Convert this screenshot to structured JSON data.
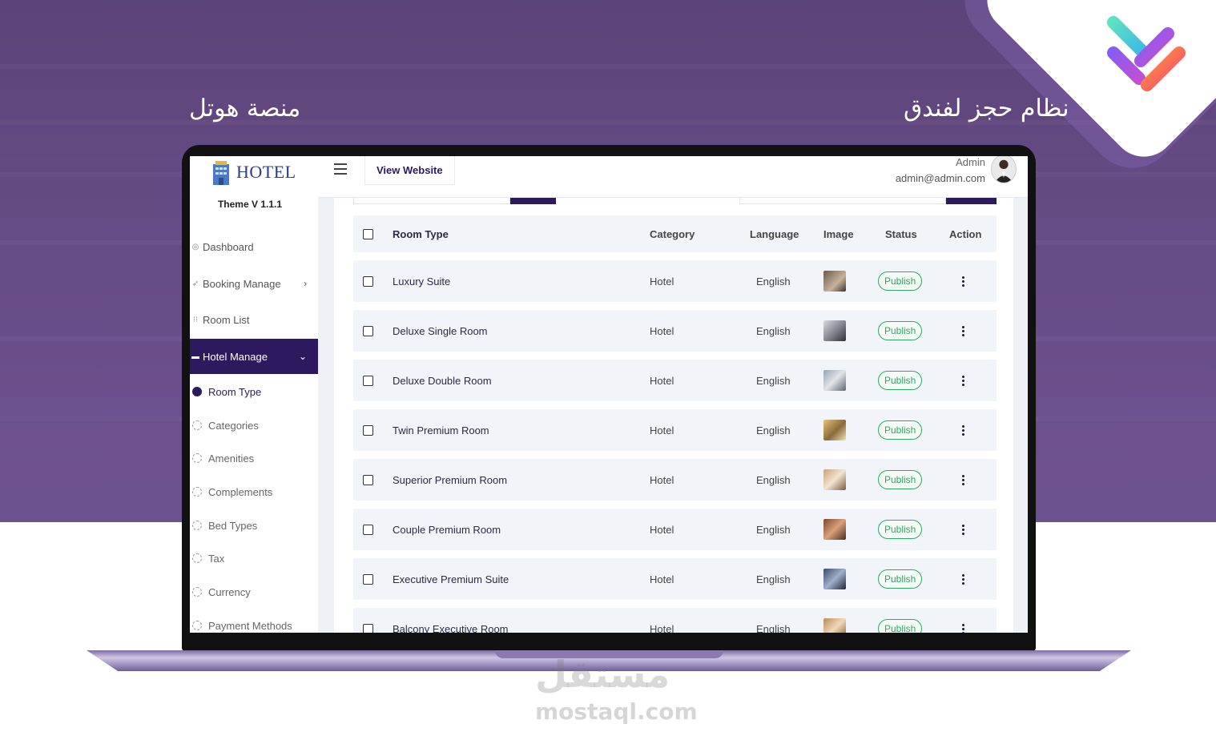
{
  "promo": {
    "title_right": "نظام حجز لفندق",
    "title_left": "منصة هوتل"
  },
  "app": {
    "logo_text": "HOTEL",
    "version": "Theme V 1.1.1"
  },
  "sidebar": {
    "items": [
      {
        "label": "Dashboard",
        "icon": "dashboard-icon"
      },
      {
        "label": "Booking Manage",
        "icon": "rocket-icon"
      },
      {
        "label": "Room List",
        "icon": "grid-icon"
      },
      {
        "label": "Hotel Manage",
        "icon": "bed-icon"
      }
    ],
    "sub_items": [
      "Room Type",
      "Categories",
      "Amenities",
      "Complements",
      "Bed Types",
      "Tax",
      "Currency",
      "Payment Methods"
    ],
    "active_sub_item": "Room Type"
  },
  "topbar": {
    "view_website_label": "View Website",
    "admin_name": "Admin",
    "admin_email": "admin@admin.com"
  },
  "table": {
    "headers": {
      "room_type": "Room Type",
      "category": "Category",
      "language": "Language",
      "image": "Image",
      "status": "Status",
      "action": "Action"
    },
    "rows": [
      {
        "room_type": "Luxury Suite",
        "category": "Hotel",
        "language": "English",
        "status": "Publish"
      },
      {
        "room_type": "Deluxe Single Room",
        "category": "Hotel",
        "language": "English",
        "status": "Publish"
      },
      {
        "room_type": "Deluxe Double Room",
        "category": "Hotel",
        "language": "English",
        "status": "Publish"
      },
      {
        "room_type": "Twin Premium Room",
        "category": "Hotel",
        "language": "English",
        "status": "Publish"
      },
      {
        "room_type": "Superior Premium Room",
        "category": "Hotel",
        "language": "English",
        "status": "Publish"
      },
      {
        "room_type": "Couple Premium Room",
        "category": "Hotel",
        "language": "English",
        "status": "Publish"
      },
      {
        "room_type": "Executive Premium Suite",
        "category": "Hotel",
        "language": "English",
        "status": "Publish"
      },
      {
        "room_type": "Balcony Executive Room",
        "category": "Hotel",
        "language": "English",
        "status": "Publish"
      }
    ]
  },
  "watermark": {
    "arabic": "مستقل",
    "latin": "mostaql.com"
  },
  "colors": {
    "accent": "#2d1a5e",
    "publish_badge": "#2fa862",
    "promo_background": "#5f477d"
  }
}
